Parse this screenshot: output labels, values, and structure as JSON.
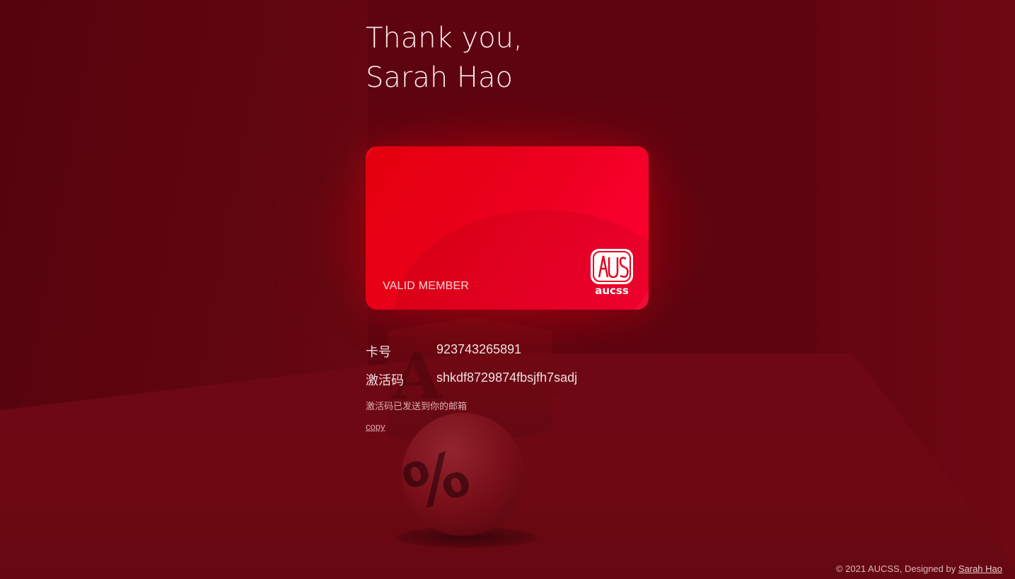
{
  "page": {
    "title_line": "Thank you,  Sarah Hao"
  },
  "card": {
    "label": "VALID MEMBER",
    "logo_text": "aucss",
    "logo_monogram": "AUCSS",
    "color_accent": "#ff0033"
  },
  "details": {
    "card_number_label": "卡号",
    "card_number_value": "923743265891",
    "activation_label": "激活码",
    "activation_value": "shkdf8729874fbsjfh7sadj",
    "sent_note": "激活码已发送到你的邮箱",
    "copy_link": "copy"
  },
  "footer": {
    "copyright": "© 2021 AUCSS, Designed by ",
    "designer_link": "Sarah Hao"
  },
  "colors": {
    "background": "#5e0410",
    "card_red": "#e9001a",
    "text": "#f3dfe1"
  }
}
